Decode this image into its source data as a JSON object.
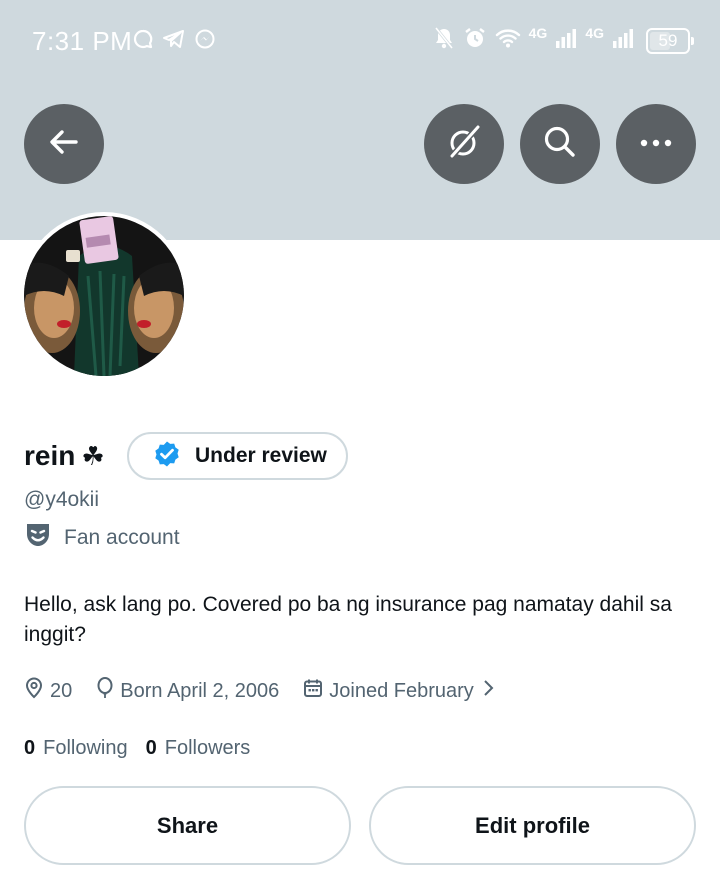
{
  "status_bar": {
    "time": "7:31 PM",
    "network_1": "4G",
    "network_2": "4G",
    "battery_percent": 59,
    "battery_text": "59"
  },
  "colors": {
    "header_bg": "#cfd9de",
    "header_button_bg": "#5b6064",
    "verified_badge": "#1d9bf0",
    "primary_text": "#0f1419",
    "secondary_text": "#536471",
    "border": "#cfd9de"
  },
  "icons": {
    "back": "arrow-left-icon",
    "grok": "grok-slash-icon",
    "search": "search-icon",
    "more": "more-horizontal-icon",
    "verified": "verified-badge-icon",
    "category": "mask-icon",
    "location": "location-pin-icon",
    "birthday": "balloon-icon",
    "joined": "calendar-icon",
    "chevron": "chevron-right-icon"
  },
  "profile": {
    "display_name": "rein",
    "name_emoji": "☘",
    "verification_label": "Under review",
    "handle": "@y4okii",
    "category": "Fan account",
    "bio": "Hello, ask lang po. Covered po ba ng insurance pag namatay dahil sa inggit?",
    "location": "20",
    "birthday": "Born April 2, 2006",
    "joined": "Joined February",
    "following_count": "0",
    "following_label": "Following",
    "followers_count": "0",
    "followers_label": "Followers"
  },
  "actions": {
    "share_label": "Share",
    "edit_label": "Edit profile"
  }
}
